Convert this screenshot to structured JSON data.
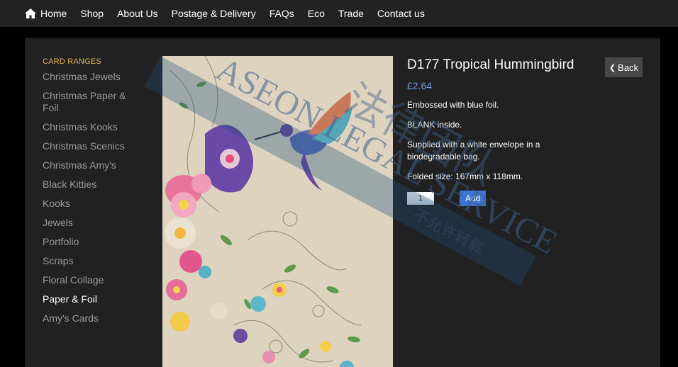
{
  "nav": {
    "items": [
      {
        "label": "Home",
        "icon": "home-icon"
      },
      {
        "label": "Shop"
      },
      {
        "label": "About Us"
      },
      {
        "label": "Postage & Delivery"
      },
      {
        "label": "FAQs"
      },
      {
        "label": "Eco"
      },
      {
        "label": "Trade"
      },
      {
        "label": "Contact us"
      }
    ]
  },
  "sidebar": {
    "heading": "CARD RANGES",
    "items": [
      {
        "label": "Christmas Jewels"
      },
      {
        "label": "Christmas Paper & Foil"
      },
      {
        "label": "Christmas Kooks"
      },
      {
        "label": "Christmas Scenics"
      },
      {
        "label": "Christmas Amy's"
      },
      {
        "label": "Black Kitties"
      },
      {
        "label": "Kooks"
      },
      {
        "label": "Jewels"
      },
      {
        "label": "Portfolio"
      },
      {
        "label": "Scraps"
      },
      {
        "label": "Floral Collage"
      },
      {
        "label": "Paper & Foil",
        "active": true
      },
      {
        "label": "Amy's Cards"
      }
    ]
  },
  "product": {
    "title": "D177 Tropical Hummingbird",
    "price": "£2.64",
    "descriptions": [
      "Embossed with blue foil.",
      "BLANK inside.",
      "Supplied with a white envelope in a biodegradable bag.",
      "Folded size: 167mm x 118mm."
    ],
    "quantity": "1",
    "add_label": "Add",
    "back_label": "Back"
  },
  "watermark": {
    "latin": "ASEON LEGAL SERVICE",
    "cjk": "法律团队",
    "cjk_small": "不允许转载"
  },
  "colors": {
    "nav_bg": "#222222",
    "panel_bg": "#212121",
    "heading_accent": "#e6b84a",
    "price": "#6f9be8",
    "add_button": "#3d75d6",
    "back_button": "#474747"
  }
}
